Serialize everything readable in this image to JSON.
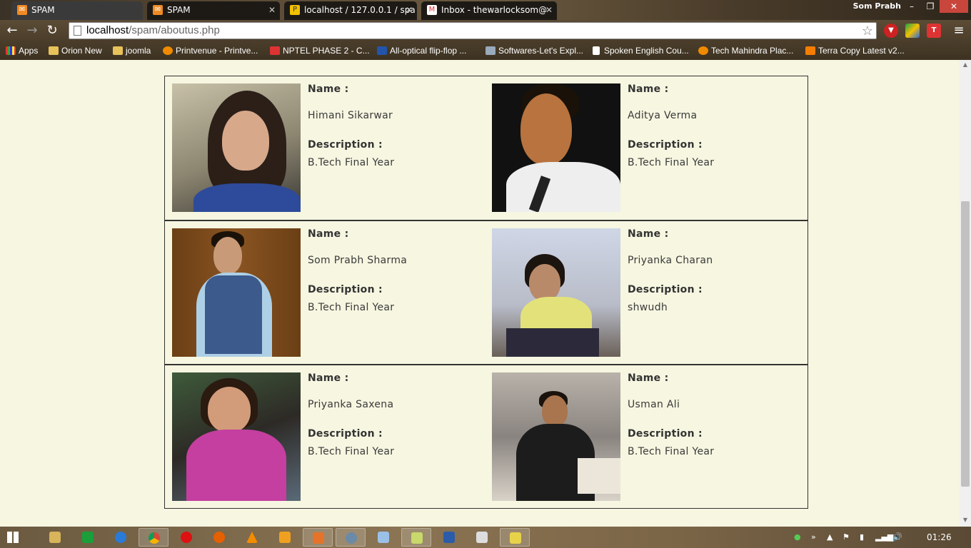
{
  "browser": {
    "tabs": [
      {
        "label": "SPAM",
        "icon": "spam-favicon-icon",
        "active": true
      },
      {
        "label": "SPAM",
        "icon": "spam-favicon-icon",
        "active": false
      },
      {
        "label": "localhost / 127.0.0.1 / spa",
        "icon": "phpmyadmin-favicon-icon",
        "active": false
      },
      {
        "label": "Inbox - thewarlocksom@",
        "icon": "gmail-favicon-icon",
        "active": false
      }
    ],
    "user": "Som Prabh",
    "url_host": "localhost",
    "url_path": "/spam/aboutus.php",
    "bookmarks": [
      {
        "label": "Apps",
        "icon": "apps-icon"
      },
      {
        "label": "Orion New",
        "icon": "folder-icon"
      },
      {
        "label": "joomla",
        "icon": "folder-icon"
      },
      {
        "label": "Printvenue - Printve...",
        "icon": "printvenue-icon"
      },
      {
        "label": "NPTEL PHASE 2 - C...",
        "icon": "nptel-icon"
      },
      {
        "label": "All-optical flip-flop ...",
        "icon": "page-icon"
      },
      {
        "label": "Softwares-Let's Expl...",
        "icon": "softwares-icon"
      },
      {
        "label": "Spoken English Cou...",
        "icon": "page-icon"
      },
      {
        "label": "Tech Mahindra Plac...",
        "icon": "techm-icon"
      },
      {
        "label": "Terra Copy Latest v2...",
        "icon": "blogger-icon"
      }
    ]
  },
  "labels": {
    "name": "Name :",
    "description": "Description :"
  },
  "members": [
    {
      "name": "Himani Sikarwar",
      "description": "B.Tech Final Year"
    },
    {
      "name": "Aditya Verma",
      "description": "B.Tech Final Year"
    },
    {
      "name": "Som Prabh Sharma",
      "description": "B.Tech Final Year"
    },
    {
      "name": "Priyanka Charan",
      "description": "shwudh"
    },
    {
      "name": "Priyanka Saxena",
      "description": "B.Tech Final Year"
    },
    {
      "name": "Usman Ali",
      "description": "B.Tech Final Year"
    }
  ],
  "taskbar": {
    "clock": "01:26"
  }
}
